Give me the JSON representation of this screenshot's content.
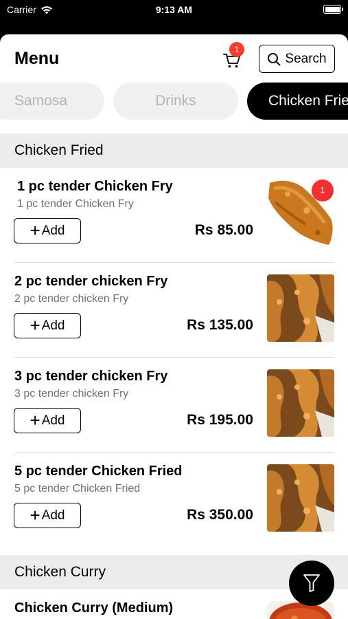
{
  "status_bar": {
    "carrier": "Carrier",
    "time": "9:13 AM"
  },
  "header": {
    "title": "Menu",
    "cart_count": "1",
    "search_label": "Search"
  },
  "categories": [
    {
      "label": "Samosa"
    },
    {
      "label": "Drinks"
    },
    {
      "label": "Chicken Fried"
    }
  ],
  "sections": [
    {
      "title": "Chicken Fried",
      "items": [
        {
          "name": "1 pc tender Chicken Fry",
          "description": "1 pc tender Chicken Fry",
          "price": "Rs 85.00",
          "add_label": "Add",
          "qty": "1"
        },
        {
          "name": "2 pc tender chicken Fry",
          "description": "2 pc tender chicken Fry",
          "price": "Rs 135.00",
          "add_label": "Add"
        },
        {
          "name": "3 pc tender chicken Fry",
          "description": "3 pc tender chicken Fry",
          "price": "Rs 195.00",
          "add_label": "Add"
        },
        {
          "name": "5 pc tender Chicken Fried",
          "description": "5 pc tender Chicken Fried",
          "price": "Rs 350.00",
          "add_label": "Add"
        }
      ]
    },
    {
      "title": "Chicken Curry",
      "items": [
        {
          "name": "Chicken Curry (Medium)"
        }
      ]
    }
  ],
  "icons": {
    "wifi": "wifi-icon",
    "battery": "battery-icon",
    "cart": "cart-icon",
    "search": "search-icon",
    "add": "plus-icon",
    "filter": "filter-icon"
  },
  "colors": {
    "badge": "#ff3b30",
    "selected_chip": "#000000",
    "chip": "#f0f0f2",
    "section_bg": "#ececef"
  }
}
